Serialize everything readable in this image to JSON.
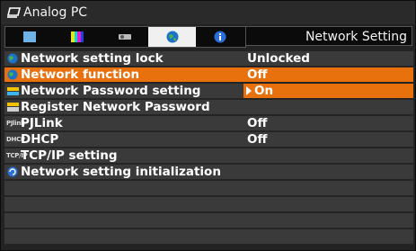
{
  "window": {
    "title": "Analog PC"
  },
  "tabs": [
    {
      "icon": "screen-icon"
    },
    {
      "icon": "color-bars-icon"
    },
    {
      "icon": "projector-icon"
    },
    {
      "icon": "network-globe-icon",
      "selected": true
    },
    {
      "icon": "info-icon"
    }
  ],
  "tab_title": "Network Setting",
  "menu": {
    "items": [
      {
        "label": "Network setting lock",
        "value": "Unlocked",
        "icon": "globe-lock-icon"
      },
      {
        "label": "Network function",
        "value": "Off",
        "icon": "globe-icon",
        "highlighted": true
      },
      {
        "label": "Network Password setting",
        "value": "On",
        "icon": "password-icon",
        "value_selected": true
      },
      {
        "label": "Register Network Password",
        "value": "",
        "icon": "register-password-icon"
      },
      {
        "label": "PJLink",
        "value": "Off",
        "icon": "pjlink-icon",
        "icon_text": "PJlink"
      },
      {
        "label": "DHCP",
        "value": "Off",
        "icon": "dhcp-icon",
        "icon_text": "DHCP"
      },
      {
        "label": "TCP/IP setting",
        "value": "",
        "icon": "tcpip-icon",
        "icon_text": "TCP/IP"
      },
      {
        "label": "Network setting initialization",
        "value": "",
        "icon": "network-reset-icon"
      }
    ]
  },
  "colors": {
    "highlight": "#e8710e",
    "row": "#3a3a3a",
    "background": "#232323"
  }
}
